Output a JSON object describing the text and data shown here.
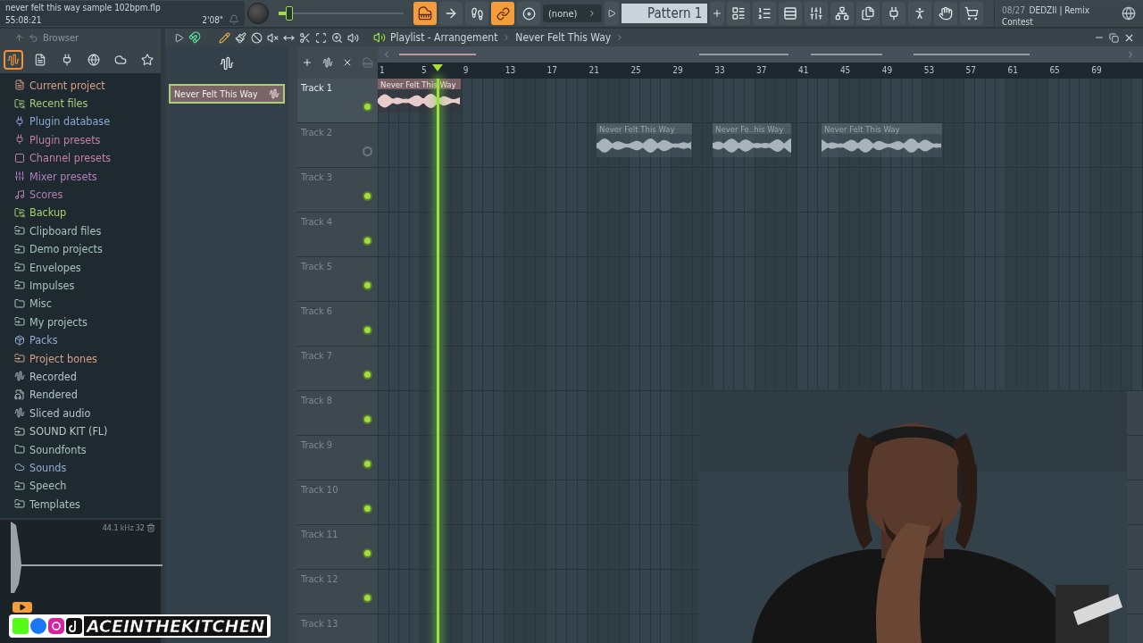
{
  "top_bar": {
    "file_name": "never felt this way sample 102bpm.flp",
    "time": "55:08:21",
    "duration": "2'08\"",
    "master_volume": {
      "level": 0.08
    },
    "pattern_selector": {
      "value": "(none)"
    },
    "pattern": {
      "value": "Pattern 1"
    },
    "news": {
      "date": "08/27",
      "title": "DEDZII | Remix",
      "subtitle": "Contest"
    }
  },
  "browser": {
    "title": "Browser",
    "items": [
      {
        "label": "Current project",
        "kind": "file",
        "color": "#d6a088"
      },
      {
        "label": "Recent files",
        "kind": "sync",
        "color": "#a9cc78"
      },
      {
        "label": "Plugin database",
        "kind": "plug",
        "color": "#8ea6d4"
      },
      {
        "label": "Plugin presets",
        "kind": "plug",
        "color": "#c67fa6"
      },
      {
        "label": "Channel presets",
        "kind": "channel",
        "color": "#c67fa6"
      },
      {
        "label": "Mixer presets",
        "kind": "mixer",
        "color": "#b27fc0"
      },
      {
        "label": "Scores",
        "kind": "note",
        "color": "#b27fb4"
      },
      {
        "label": "Backup",
        "kind": "sync",
        "color": "#a9d070"
      },
      {
        "label": "Clipboard files",
        "kind": "folder-plus",
        "color": "#a8c4bc"
      },
      {
        "label": "Demo projects",
        "kind": "folder-plus",
        "color": "#a8c4bc"
      },
      {
        "label": "Envelopes",
        "kind": "folder-plus",
        "color": "#a8c4bc"
      },
      {
        "label": "Impulses",
        "kind": "folder-plus",
        "color": "#a8c4bc"
      },
      {
        "label": "Misc",
        "kind": "folder",
        "color": "#a8c4bc"
      },
      {
        "label": "My projects",
        "kind": "folder-plus",
        "color": "#a8c4bc"
      },
      {
        "label": "Packs",
        "kind": "packs",
        "color": "#92aad6"
      },
      {
        "label": "Project bones",
        "kind": "folder-plus",
        "color": "#d6a088"
      },
      {
        "label": "Recorded",
        "kind": "wave",
        "color": "#b4c4cc"
      },
      {
        "label": "Rendered",
        "kind": "render",
        "color": "#b4c4cc"
      },
      {
        "label": "Sliced audio",
        "kind": "wave",
        "color": "#b4c4cc"
      },
      {
        "label": "SOUND KIT (FL)",
        "kind": "folder-plus",
        "color": "#b4c8c4"
      },
      {
        "label": "Soundfonts",
        "kind": "folder",
        "color": "#a8c4bc"
      },
      {
        "label": "Sounds",
        "kind": "cloud",
        "color": "#92aad6"
      },
      {
        "label": "Speech",
        "kind": "folder-plus",
        "color": "#a8c4bc"
      },
      {
        "label": "Templates",
        "kind": "folder-plus",
        "color": "#a8c4bc"
      }
    ],
    "sample_info": {
      "rate": "44.1",
      "unit": "kHz",
      "bits": "32"
    }
  },
  "playlist": {
    "title": "Playlist - Arrangement",
    "breadcrumb": "Never Felt This Way",
    "picker_clips": [
      {
        "label": "Never Felt This Way",
        "selected": true
      }
    ],
    "ruler": [
      "1",
      "5",
      "9",
      "13",
      "17",
      "21",
      "25",
      "29",
      "33",
      "37",
      "41",
      "45",
      "49",
      "53",
      "57",
      "61",
      "65",
      "69"
    ],
    "playhead": {
      "level": 0.077
    },
    "tracks": [
      {
        "name": "Track 1",
        "enabled": true,
        "selected": true,
        "clips": [
          {
            "label": "Never Felt This Way",
            "muted": false
          }
        ]
      },
      {
        "name": "Track 2",
        "enabled": false,
        "selected": false,
        "clips": [
          {
            "label": "Never Felt This Way",
            "muted": true
          },
          {
            "label": "Never Fe..his Way",
            "muted": true
          },
          {
            "label": "Never Felt This Way",
            "muted": true
          }
        ]
      },
      {
        "name": "Track 3",
        "enabled": true,
        "selected": false
      },
      {
        "name": "Track 4",
        "enabled": true,
        "selected": false
      },
      {
        "name": "Track 5",
        "enabled": true,
        "selected": false
      },
      {
        "name": "Track 6",
        "enabled": true,
        "selected": false
      },
      {
        "name": "Track 7",
        "enabled": true,
        "selected": false
      },
      {
        "name": "Track 8",
        "enabled": true,
        "selected": false
      },
      {
        "name": "Track 9",
        "enabled": true,
        "selected": false
      },
      {
        "name": "Track 10",
        "enabled": true,
        "selected": false
      },
      {
        "name": "Track 11",
        "enabled": true,
        "selected": false
      },
      {
        "name": "Track 12",
        "enabled": true,
        "selected": false
      },
      {
        "name": "Track 13",
        "selected": false
      }
    ]
  },
  "stream_overlay": {
    "handle": "ACEINTHEKITCHEN"
  }
}
